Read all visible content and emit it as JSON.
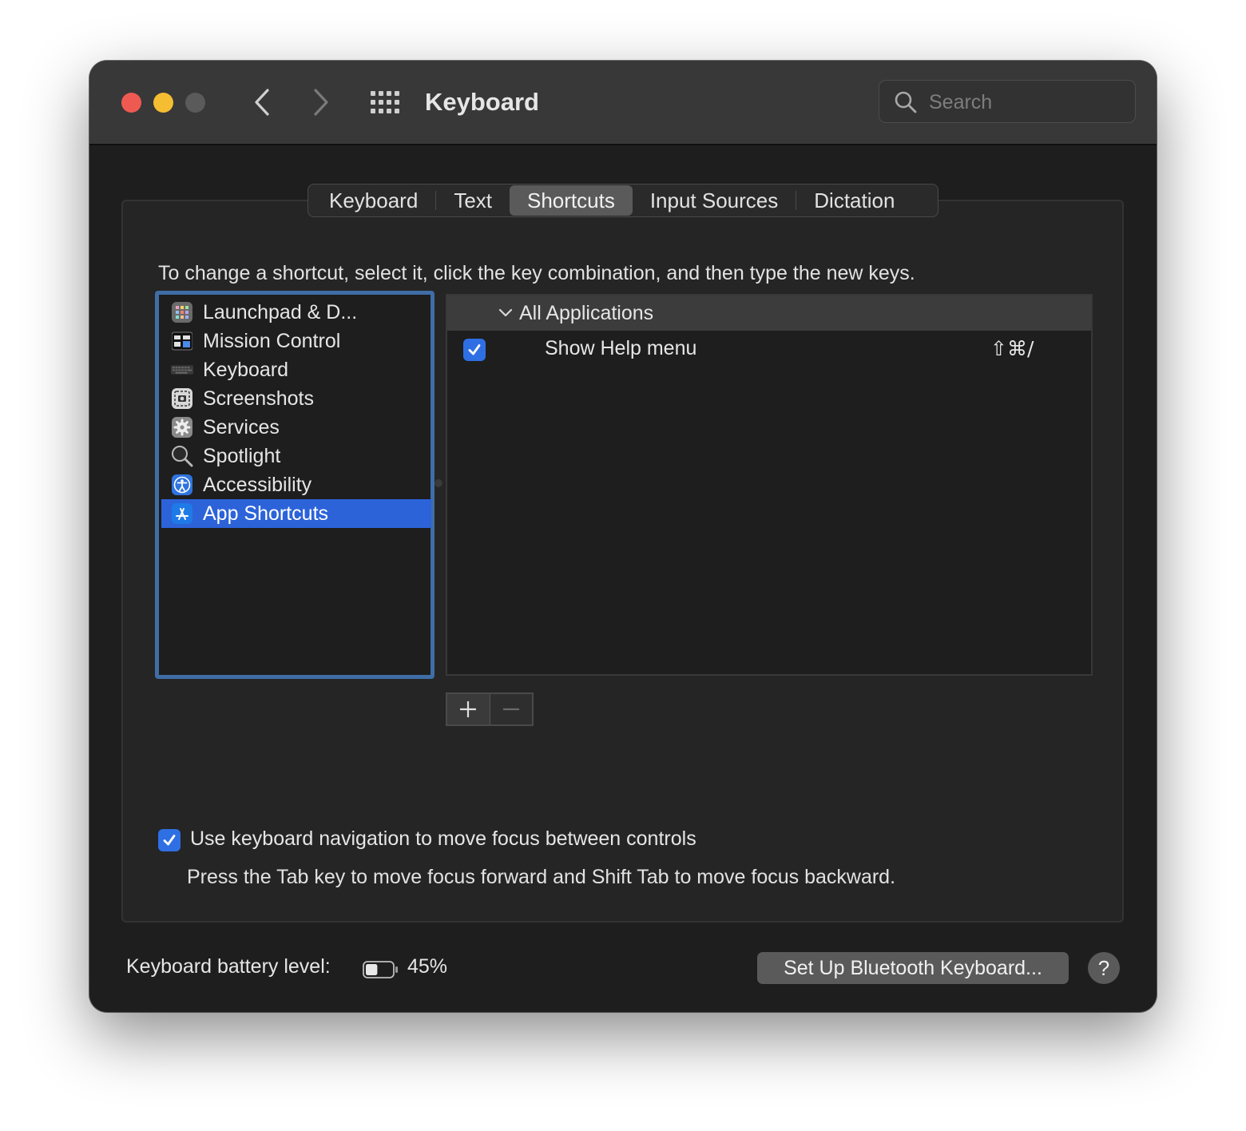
{
  "window": {
    "title": "Keyboard",
    "search_placeholder": "Search"
  },
  "tabs": [
    {
      "label": "Keyboard",
      "active": false
    },
    {
      "label": "Text",
      "active": false
    },
    {
      "label": "Shortcuts",
      "active": true
    },
    {
      "label": "Input Sources",
      "active": false
    },
    {
      "label": "Dictation",
      "active": false
    }
  ],
  "instruction": "To change a shortcut, select it, click the key combination, and then type the new keys.",
  "categories": [
    {
      "label": "Launchpad & D...",
      "icon": "launchpad-icon",
      "selected": false
    },
    {
      "label": "Mission Control",
      "icon": "mission-control-icon",
      "selected": false
    },
    {
      "label": "Keyboard",
      "icon": "keyboard-icon",
      "selected": false
    },
    {
      "label": "Screenshots",
      "icon": "screenshot-icon",
      "selected": false
    },
    {
      "label": "Services",
      "icon": "gear-icon",
      "selected": false
    },
    {
      "label": "Spotlight",
      "icon": "magnifier-icon",
      "selected": false
    },
    {
      "label": "Accessibility",
      "icon": "accessibility-icon",
      "selected": false
    },
    {
      "label": "App Shortcuts",
      "icon": "app-store-icon",
      "selected": true
    }
  ],
  "shortcuts": {
    "group_label": "All Applications",
    "rows": [
      {
        "name": "Show Help menu",
        "keys": "⇧⌘/",
        "checked": true
      }
    ]
  },
  "keyboard_navigation": {
    "checked": true,
    "label": "Use keyboard navigation to move focus between controls",
    "help": "Press the Tab key to move focus forward and Shift Tab to move focus backward."
  },
  "footer": {
    "battery_label": "Keyboard battery level:",
    "battery_percent": "45%",
    "battery_level": 0.45,
    "bluetooth_button": "Set Up Bluetooth Keyboard...",
    "help_button": "?"
  },
  "colors": {
    "accent": "#2c63d9",
    "checkbox": "#2f6fe4",
    "close": "#ee5a52",
    "minimize": "#f5bd31"
  }
}
